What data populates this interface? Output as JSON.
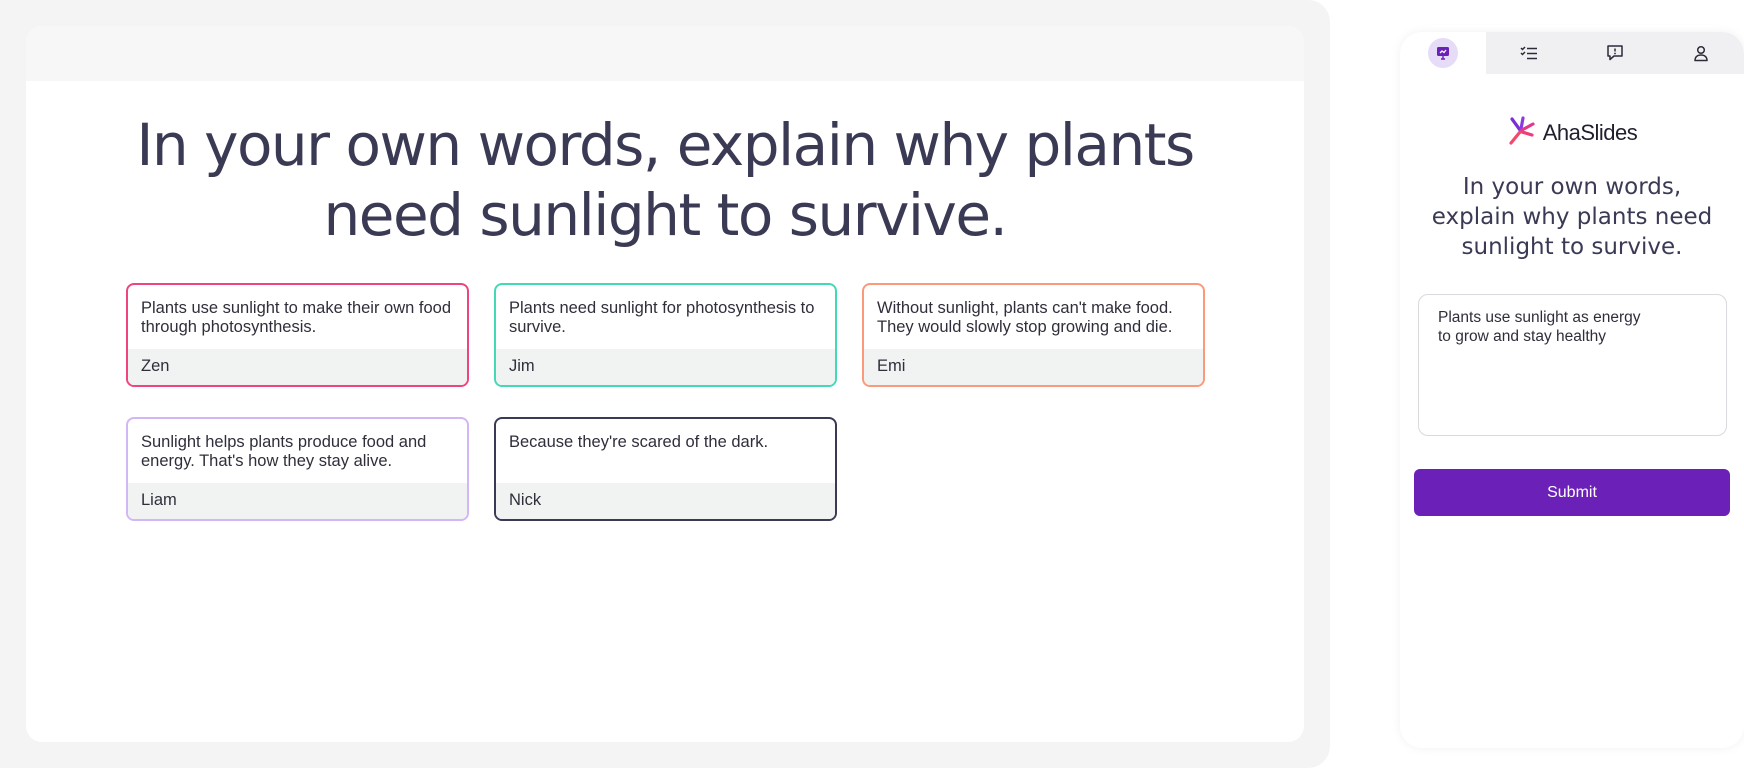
{
  "slide": {
    "question": "In your own words, explain why plants need sunlight to survive.",
    "responses": [
      {
        "text": "Plants use sunlight to make their own food through photosynthesis.",
        "author": "Zen",
        "border_color": "#f0457c"
      },
      {
        "text": "Plants need sunlight for photosynthesis to survive.",
        "author": "Jim",
        "border_color": "#43d9b8"
      },
      {
        "text": "Without sunlight, plants can't make food. They would slowly stop growing and die.",
        "author": "Emi",
        "border_color": "#fb9a7a"
      },
      {
        "text": "Sunlight helps plants produce food and energy. That's how they stay alive.",
        "author": "Liam",
        "border_color": "#d2b6f5"
      },
      {
        "text": "Because they're scared of the dark.",
        "author": "Nick",
        "border_color": "#3a3a55"
      }
    ]
  },
  "phone": {
    "tabs": [
      {
        "name": "presentation-icon",
        "active": true
      },
      {
        "name": "checklist-icon",
        "active": false
      },
      {
        "name": "chat-icon",
        "active": false
      },
      {
        "name": "user-icon",
        "active": false
      }
    ],
    "logo_text": "AhaSlides",
    "question": "In your own words, explain why plants need sunlight to survive.",
    "answer_value": "Plants use sunlight as energy\nto grow and stay healthy",
    "submit_label": "Submit",
    "accent_color": "#6b21b7"
  }
}
